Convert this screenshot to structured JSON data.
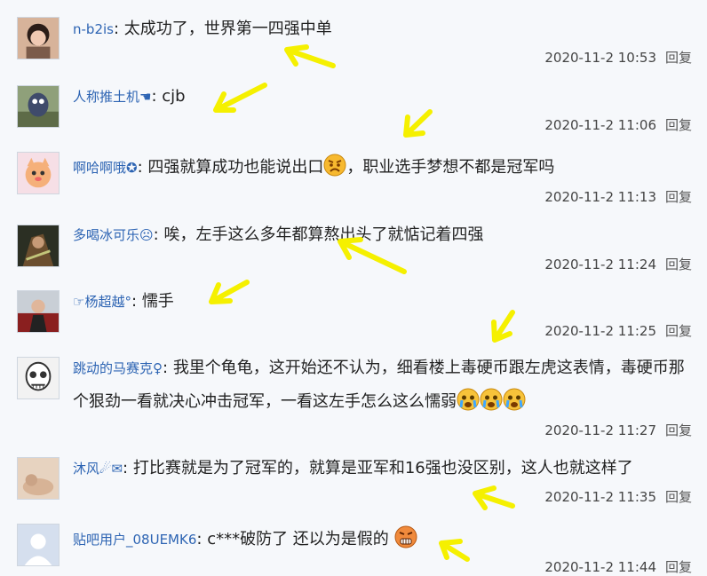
{
  "comments": [
    {
      "user": "n-b2is",
      "text": "太成功了，世界第一四强中单",
      "time": "2020-11-2 10:53",
      "reply": "回复"
    },
    {
      "user": "人称推土机☚",
      "text": "cjb",
      "time": "2020-11-2 11:06",
      "reply": "回复"
    },
    {
      "user": "啊哈啊哦✪",
      "text_a": "四强就算成功也能说出口",
      "text_b": "，职业选手梦想不都是冠军吗",
      "time": "2020-11-2 11:13",
      "reply": "回复"
    },
    {
      "user": "多喝冰可乐☹",
      "text": "唉，左手这么多年都算熬出头了就惦记着四强",
      "time": "2020-11-2 11:24",
      "reply": "回复"
    },
    {
      "user": "☞杨超越°",
      "text": "懦手",
      "time": "2020-11-2 11:25",
      "reply": "回复"
    },
    {
      "user": "跳动的马赛克♀",
      "text": "我里个龟龟，这开始还不认为，细看楼上毒硬币跟左虎这表情，毒硬币那个狠劲一看就决心冲击冠军，一看这左手怎么这么懦弱",
      "time": "2020-11-2 11:27",
      "reply": "回复"
    },
    {
      "user": "沐风☄✉",
      "text": "打比赛就是为了冠军的，就算是亚军和16强也没区别，这人也就这样了",
      "time": "2020-11-2 11:35",
      "reply": "回复"
    },
    {
      "user": "贴吧用户_08UEMK6",
      "text": "c***破防了 还以为是假的",
      "time": "2020-11-2 11:44",
      "reply": "回复"
    }
  ],
  "separator": ":",
  "colors": {
    "background": "#f6f8fb",
    "username": "#2d64b3",
    "arrow": "#f5f000"
  }
}
